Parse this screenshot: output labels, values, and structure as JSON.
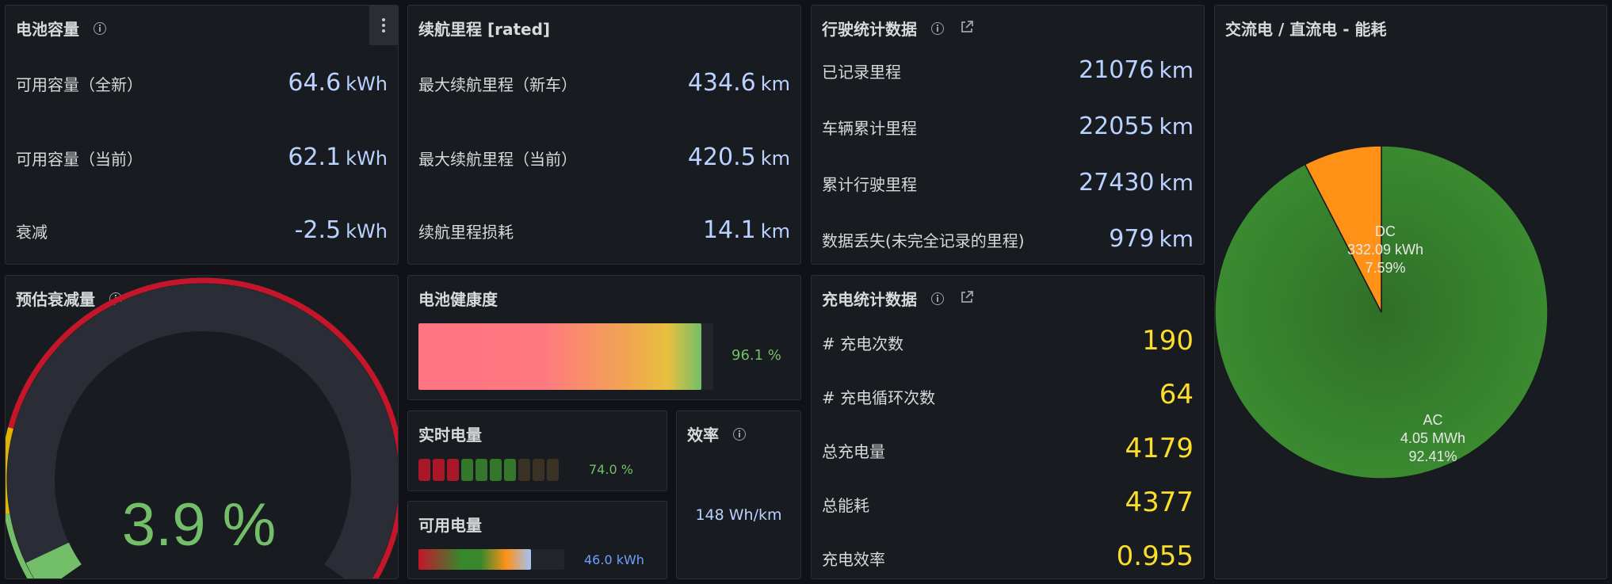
{
  "battery_capacity": {
    "title": "电池容量",
    "rows": [
      {
        "label": "可用容量（全新）",
        "value": "64.6",
        "unit": "kWh"
      },
      {
        "label": "可用容量（当前）",
        "value": "62.1",
        "unit": "kWh"
      },
      {
        "label": "衰减",
        "value": "-2.5",
        "unit": "kWh"
      }
    ]
  },
  "range": {
    "title": "续航里程 [rated]",
    "rows": [
      {
        "label": "最大续航里程（新车）",
        "value": "434.6",
        "unit": "km"
      },
      {
        "label": "最大续航里程（当前）",
        "value": "420.5",
        "unit": "km"
      },
      {
        "label": "续航里程损耗",
        "value": "14.1",
        "unit": "km"
      }
    ]
  },
  "drive_stats": {
    "title": "行驶统计数据",
    "rows": [
      {
        "label": "已记录里程",
        "value": "21076",
        "unit": "km"
      },
      {
        "label": "车辆累计里程",
        "value": "22055",
        "unit": "km"
      },
      {
        "label": "累计行驶里程",
        "value": "27430",
        "unit": "km"
      },
      {
        "label": "数据丢失(未完全记录的里程)",
        "value": "979",
        "unit": "km"
      }
    ]
  },
  "ac_dc": {
    "title": "交流电 / 直流电 - 能耗",
    "slices": [
      {
        "name": "DC",
        "value": "332.09 kWh",
        "percent": "7.59%",
        "fraction": 0.0759,
        "color": "#ff9117"
      },
      {
        "name": "AC",
        "value": "4.05 MWh",
        "percent": "92.41%",
        "fraction": 0.9241,
        "color": "#37872d"
      }
    ]
  },
  "degradation": {
    "title": "预估衰减量",
    "value": "3.9 %",
    "fraction": 0.039,
    "colors": {
      "good": "#73bf69",
      "warn": "#e0b400",
      "bad": "#c4162a"
    }
  },
  "battery_health": {
    "title": "电池健康度",
    "value": "96.1 %",
    "fraction": 0.961
  },
  "live_soc": {
    "title": "实时电量",
    "value": "74.0 %",
    "segments": 10,
    "fraction": 0.74
  },
  "efficiency": {
    "title": "效率",
    "value": "148 Wh/km"
  },
  "usable_energy": {
    "title": "可用电量",
    "value": "46.0 kWh",
    "fraction": 0.77
  },
  "charge_stats": {
    "title": "充电统计数据",
    "rows": [
      {
        "label": "# 充电次数",
        "value": "190"
      },
      {
        "label": "# 充电循环次数",
        "value": "64"
      },
      {
        "label": "总充电量",
        "value": "4179"
      },
      {
        "label": "总能耗",
        "value": "4377"
      },
      {
        "label": "充电效率",
        "value": "0.955"
      }
    ]
  }
}
